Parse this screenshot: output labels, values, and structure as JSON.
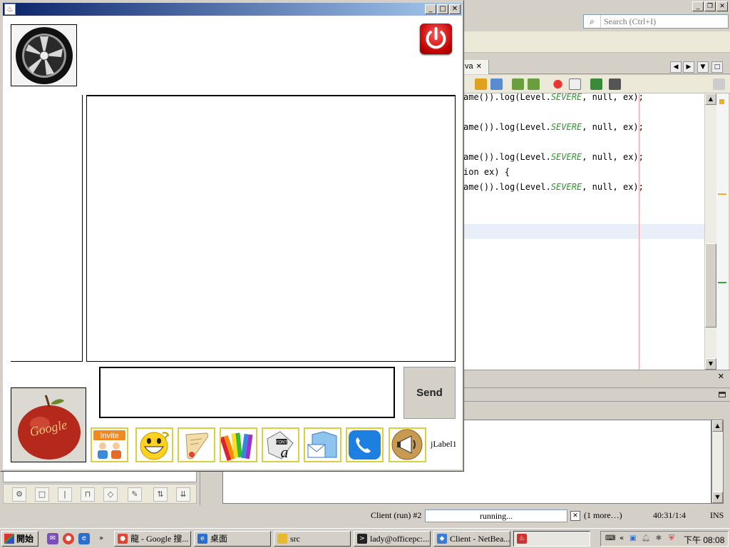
{
  "ide": {
    "search_placeholder": "Search (Ctrl+I)",
    "tab_label": "va",
    "code_lines": [
      {
        "pre": "ame()).log(Level.",
        "kw": "SEVERE",
        "post": ", null, ex);"
      },
      {
        "pre": "ame()).log(Level.",
        "kw": "SEVERE",
        "post": ", null, ex);"
      },
      {
        "pre": "ame()).log(Level.",
        "kw": "SEVERE",
        "post": ", null, ex);"
      },
      {
        "pre": "ion ex) {",
        "kw": "",
        "post": ""
      },
      {
        "pre": "ame()).log(Level.",
        "kw": "SEVERE",
        "post": ", null, ex);"
      }
    ],
    "status": {
      "run_label": "Client (run) #2",
      "progress_text": "running...",
      "more": "(1 more…)",
      "position": "40:31/1:4",
      "mode": "INS"
    }
  },
  "chat": {
    "send_label": "Send",
    "jlabel": "jLabel1",
    "invite_label": "Invite",
    "google_text": "Google",
    "font_text": "FONT",
    "tools": [
      "invite-icon",
      "smiley-icon",
      "scroll-icon",
      "color-palette-icon",
      "font-icon",
      "mail-folder-icon",
      "phone-icon",
      "megaphone-icon"
    ]
  },
  "taskbar": {
    "start_label": "開始",
    "more_arrows": "»",
    "tasks": [
      {
        "label": "龍 - Google 搜...",
        "icon": "chrome-icon",
        "color": "#dd4433"
      },
      {
        "label": "桌面",
        "icon": "ie-icon",
        "color": "#2a6fd0"
      },
      {
        "label": "src",
        "icon": "folder-icon",
        "color": "#e8b830"
      },
      {
        "label": "lady@officepc:...",
        "icon": "terminal-icon",
        "color": "#222222"
      },
      {
        "label": "Client - NetBea...",
        "icon": "netbeans-icon",
        "color": "#3a7bd5"
      },
      {
        "label": "",
        "icon": "java-icon",
        "color": "#c33333"
      }
    ],
    "tray_collapse": "«",
    "clock": "下午 08:08"
  }
}
